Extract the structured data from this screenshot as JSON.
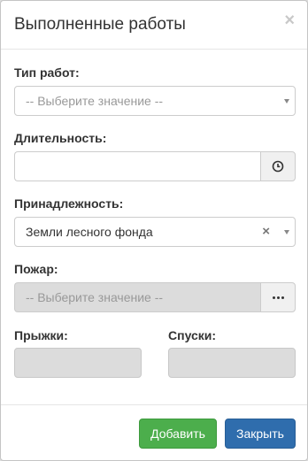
{
  "modal": {
    "title": "Выполненные работы",
    "close_glyph": "×"
  },
  "fields": {
    "work_type": {
      "label": "Тип работ:",
      "placeholder": "-- Выберите значение --"
    },
    "duration": {
      "label": "Длительность:",
      "value": "",
      "icon": "clock-icon"
    },
    "ownership": {
      "label": "Принадлежность:",
      "value": "Земли лесного фонда",
      "clear_glyph": "×"
    },
    "fire": {
      "label": "Пожар:",
      "placeholder": "-- Выберите значение --",
      "button": "ellipsis-icon"
    },
    "jumps": {
      "label": "Прыжки:",
      "value": ""
    },
    "descents": {
      "label": "Спуски:",
      "value": ""
    }
  },
  "footer": {
    "add_label": "Добавить",
    "close_label": "Закрыть"
  },
  "colors": {
    "success": "#4cae4c",
    "primary": "#2f6dad",
    "disabled_bg": "#dcdcdc"
  }
}
